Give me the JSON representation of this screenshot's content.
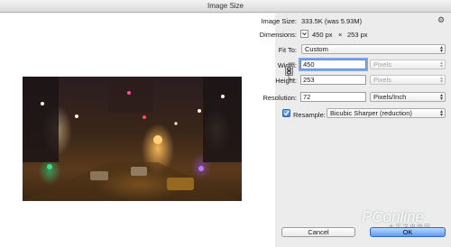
{
  "window": {
    "title": "Image Size"
  },
  "image_size": {
    "label": "Image Size:",
    "value": "333.5K (was 5.93M)"
  },
  "dimensions": {
    "label": "Dimensions:",
    "width_value": "450 px",
    "separator": "×",
    "height_value": "253 px"
  },
  "fit_to": {
    "label": "Fit To:",
    "selected": "Custom"
  },
  "width": {
    "label": "Width:",
    "value": "450",
    "unit": "Pixels"
  },
  "height": {
    "label": "Height:",
    "value": "253",
    "unit": "Pixels"
  },
  "resolution": {
    "label": "Resolution:",
    "value": "72",
    "unit": "Pixels/Inch"
  },
  "resample": {
    "label": "Resample:",
    "checked": true,
    "method": "Bicubic Sharper (reduction)"
  },
  "buttons": {
    "cancel": "Cancel",
    "ok": "OK"
  },
  "watermark": {
    "text": "PConline",
    "sub": "太平洋电脑网"
  },
  "icons": {
    "settings": "gear-icon",
    "dimensions_menu": "chevron-down-icon",
    "link": "chain-link-icon",
    "select_arrows": "updown-arrows-icon",
    "checkbox": "checkmark-icon"
  }
}
